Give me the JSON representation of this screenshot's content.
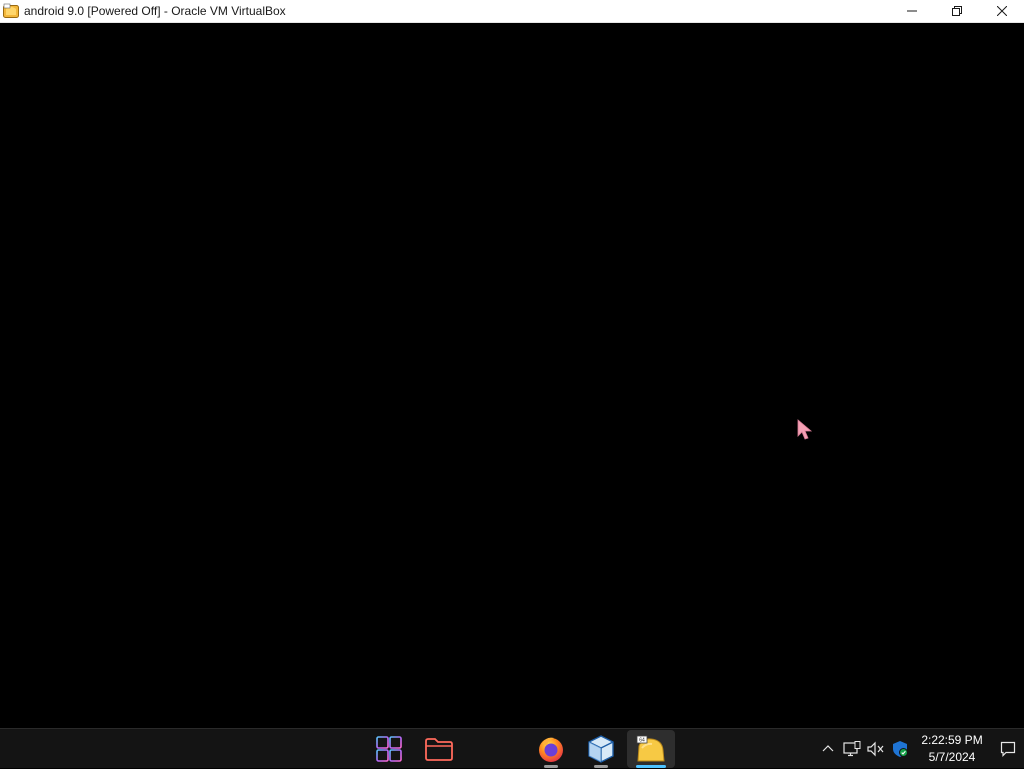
{
  "window": {
    "title": "android 9.0 [Powered Off] - Oracle VM VirtualBox",
    "controls": {
      "minimize_icon": "minimize-icon",
      "restore_icon": "restore-icon",
      "close_icon": "close-icon"
    }
  },
  "vm_display": {
    "state": "Powered Off",
    "background": "#000000",
    "cursor_color": "#f4a0b4"
  },
  "taskbar": {
    "pinned_apps": [
      {
        "name": "Start",
        "icon": "start-icon",
        "active": false
      },
      {
        "name": "File Explorer",
        "icon": "folder-icon",
        "active": false
      },
      {
        "name": "Firefox",
        "icon": "firefox-icon",
        "active": false,
        "running": true
      },
      {
        "name": "Oracle VM VirtualBox",
        "icon": "virtualbox-icon",
        "active": false,
        "running": true
      },
      {
        "name": "android 9.0",
        "icon": "vm-icon",
        "active": true,
        "running": true
      }
    ],
    "indicator_color": "#4cc2ff",
    "tray": {
      "chevron_icon": "chevron-up-icon",
      "icons": [
        "network-icon",
        "volume-muted-icon",
        "defender-icon"
      ],
      "clock": {
        "time": "2:22:59 PM",
        "date": "5/7/2024"
      },
      "notification_icon": "notification-icon"
    }
  }
}
